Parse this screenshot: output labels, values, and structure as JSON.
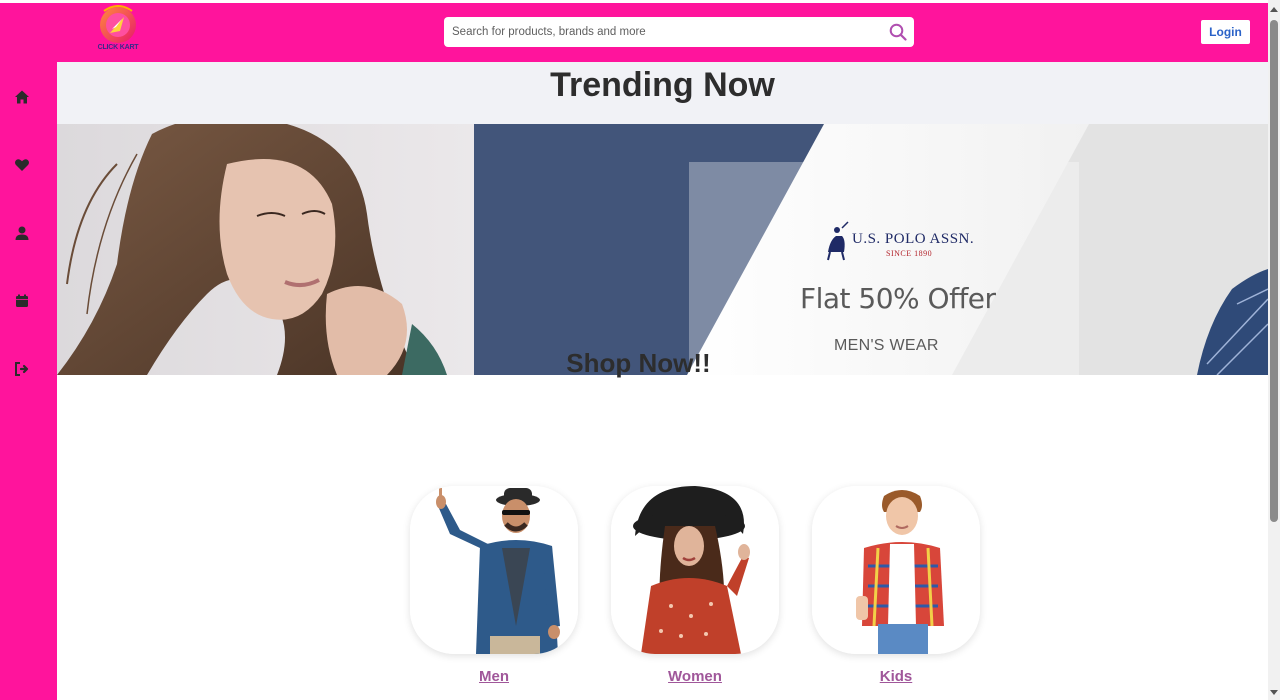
{
  "app": {
    "logo_text": "CLICK KART"
  },
  "header": {
    "search_placeholder": "Search for products, brands and more",
    "login_label": "Login"
  },
  "sidebar": {
    "items": [
      {
        "icon": "home-icon"
      },
      {
        "icon": "heart-icon"
      },
      {
        "icon": "user-icon"
      },
      {
        "icon": "calendar-icon"
      },
      {
        "icon": "logout-icon"
      }
    ]
  },
  "trending": {
    "title": "Trending Now",
    "banner": {
      "brand": "U.S. POLO ASSN.",
      "since": "SINCE 1890",
      "offer": "Flat 50% Offer",
      "category": "MEN'S WEAR"
    }
  },
  "shop": {
    "title": "Shop Now!!",
    "categories": [
      {
        "label": "Men"
      },
      {
        "label": "Women"
      },
      {
        "label": "Kids"
      }
    ]
  },
  "colors": {
    "brand_pink": "#ff149c",
    "link_purple": "#a0579a",
    "login_blue": "#2a62c8"
  }
}
